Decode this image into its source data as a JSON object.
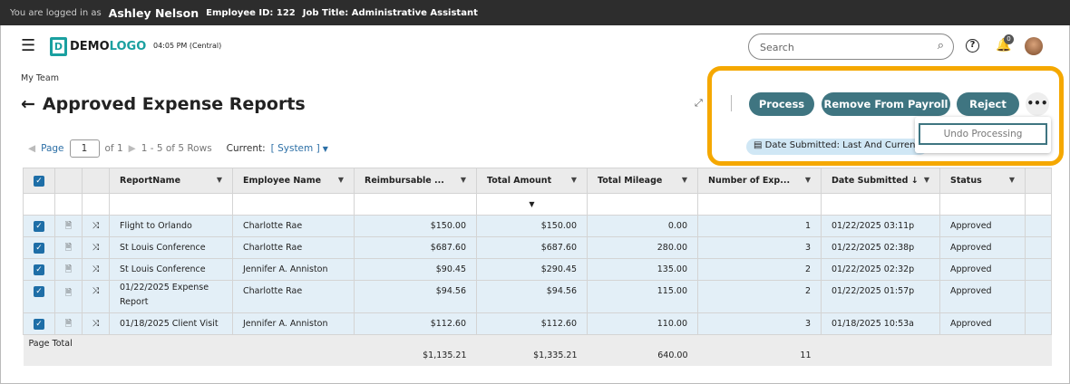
{
  "topbar": {
    "logged_in_label": "You are logged in as",
    "user_name": "Ashley Nelson",
    "employee_id": "Employee ID: 122",
    "job_title": "Job Title: Administrative Assistant"
  },
  "header": {
    "logo_demo": "DEMO",
    "logo_logo": "LOGO",
    "time": "04:05 PM (Central)",
    "search_placeholder": "Search",
    "help": "?",
    "notifications": "0"
  },
  "breadcrumb": "My Team",
  "page_title": "Approved Expense Reports",
  "pager": {
    "page_label": "Page",
    "page_value": "1",
    "of": "of 1",
    "rows": "1 - 5 of 5 Rows",
    "current_label": "Current:",
    "current_view": "[ System ]"
  },
  "actions": {
    "process": "Process",
    "remove": "Remove From Payroll",
    "reject": "Reject",
    "more": "•••",
    "undo": "Undo Processing"
  },
  "filter_chip": "Date Submitted: Last And Current Quarter",
  "highlight_color": "#f5a800",
  "table": {
    "columns": [
      "ReportName",
      "Employee Name",
      "Reimbursable ...",
      "Total Amount",
      "Total Mileage",
      "Number of Exp...",
      "Date Submitted",
      "Status"
    ],
    "rows": [
      [
        "Flight to Orlando",
        "Charlotte Rae",
        "$150.00",
        "$150.00",
        "0.00",
        "1",
        "01/22/2025 03:11p",
        "Approved"
      ],
      [
        "St Louis Conference",
        "Charlotte Rae",
        "$687.60",
        "$687.60",
        "280.00",
        "3",
        "01/22/2025 02:38p",
        "Approved"
      ],
      [
        "St Louis Conference",
        "Jennifer A. Anniston",
        "$90.45",
        "$290.45",
        "135.00",
        "2",
        "01/22/2025 02:32p",
        "Approved"
      ],
      [
        "01/22/2025 Expense Report",
        "Charlotte Rae",
        "$94.56",
        "$94.56",
        "115.00",
        "2",
        "01/22/2025 01:57p",
        "Approved"
      ],
      [
        "01/18/2025 Client Visit",
        "Jennifer A. Anniston",
        "$112.60",
        "$112.60",
        "110.00",
        "3",
        "01/18/2025 10:53a",
        "Approved"
      ]
    ],
    "total_label": "Page Total",
    "totals": [
      "$1,135.21",
      "$1,335.21",
      "640.00",
      "11"
    ]
  }
}
